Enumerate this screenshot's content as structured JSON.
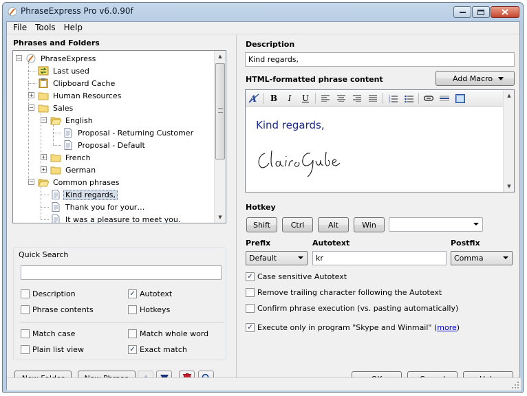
{
  "window": {
    "title": "PhraseExpress Pro v6.0.90f"
  },
  "menu": [
    "File",
    "Tools",
    "Help"
  ],
  "left": {
    "title": "Phrases and Folders",
    "tree": [
      {
        "label": "PhraseExpress",
        "level": 0,
        "icon": "app-logo-icon",
        "expander": "-"
      },
      {
        "label": "Last used",
        "level": 1,
        "icon": "last-used-icon"
      },
      {
        "label": "Clipboard Cache",
        "level": 1,
        "icon": "clipboard-icon"
      },
      {
        "label": "Human Resources",
        "level": 1,
        "icon": "folder-icon",
        "expander": "+"
      },
      {
        "label": "Sales",
        "level": 1,
        "icon": "folder-icon",
        "expander": "-"
      },
      {
        "label": "English",
        "level": 2,
        "icon": "folder-open-icon",
        "expander": "-"
      },
      {
        "label": "Proposal - Returning Customer",
        "level": 3,
        "icon": "document-icon"
      },
      {
        "label": "Proposal - Default",
        "level": 3,
        "icon": "document-icon"
      },
      {
        "label": "French",
        "level": 2,
        "icon": "folder-icon",
        "expander": "+"
      },
      {
        "label": "German",
        "level": 2,
        "icon": "folder-icon",
        "expander": "+"
      },
      {
        "label": "Common phrases",
        "level": 1,
        "icon": "folder-open-icon",
        "expander": "-"
      },
      {
        "label": "Kind regards,",
        "level": 2,
        "icon": "document-icon",
        "selected": true
      },
      {
        "label": "Thank you for your…",
        "level": 2,
        "icon": "document-icon"
      },
      {
        "label": "It was a pleasure to meet you.",
        "level": 2,
        "icon": "document-icon"
      }
    ],
    "quick_search": {
      "label": "Quick Search",
      "value": "",
      "options": [
        {
          "label": "Description",
          "checked": false
        },
        {
          "label": "Autotext",
          "checked": true
        },
        {
          "label": "Phrase contents",
          "checked": false
        },
        {
          "label": "Hotkeys",
          "checked": false
        },
        {
          "label": "Match case",
          "checked": false
        },
        {
          "label": "Match whole word",
          "checked": false
        },
        {
          "label": "Plain list view",
          "checked": false
        },
        {
          "label": "Exact match",
          "checked": true
        }
      ]
    },
    "buttons": {
      "new_folder": "New Folder",
      "new_phrase": "New Phrase"
    }
  },
  "right": {
    "description_label": "Description",
    "description_value": "Kind regards,",
    "content_label": "HTML-formatted phrase content",
    "add_macro": "Add Macro",
    "editor_text": "Kind regards,",
    "signature": "Claire Grube",
    "hotkey": {
      "label": "Hotkey",
      "shift": "Shift",
      "ctrl": "Ctrl",
      "alt": "Alt",
      "win": "Win",
      "key_value": ""
    },
    "prefix": {
      "label": "Prefix",
      "value": "Default"
    },
    "autotext": {
      "label": "Autotext",
      "value": "kr"
    },
    "postfix": {
      "label": "Postfix",
      "value": "Comma"
    },
    "options": [
      {
        "label": "Case sensitive Autotext",
        "checked": true
      },
      {
        "label": "Remove trailing character following the Autotext",
        "checked": false
      },
      {
        "label": "Confirm phrase execution (vs. pasting automatically)",
        "checked": false
      }
    ],
    "execute_only": {
      "label": "Execute only in program \"Skype and Winmail\" (",
      "link": "more",
      "suffix": ")",
      "checked": true
    },
    "buttons": {
      "ok": "OK",
      "cancel": "Cancel",
      "help": "Help"
    }
  },
  "colors": {
    "accent": "#1a2a8a",
    "title_bar": "#b9cfe5",
    "selection": "#d4dde8"
  }
}
